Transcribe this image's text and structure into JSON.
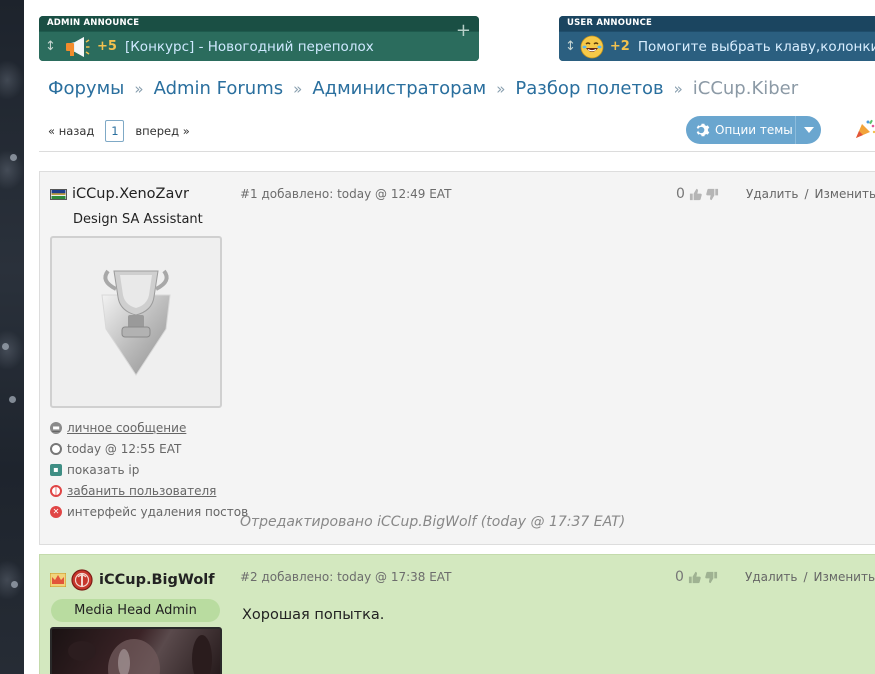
{
  "announce_admin": {
    "tag": "ADMIN ANNOUNCE",
    "score": "+5",
    "text": "[Конкурс] - Новогодний переполох",
    "icon": "megaphone-icon"
  },
  "announce_user": {
    "tag": "USER ANNOUNCE",
    "score": "+2",
    "text": "Помогите выбрать клаву,колонки,нау",
    "icon": "laughing-emoji-icon"
  },
  "breadcrumb": {
    "items": [
      "Форумы",
      "Admin Forums",
      "Администраторам",
      "Разбор полетов"
    ],
    "current": "iCCup.Kiber",
    "separator": "»"
  },
  "pager": {
    "prev": "« назад",
    "page": "1",
    "next": "вперед »"
  },
  "toolbar": {
    "options_label": "Опции темы"
  },
  "posts": [
    {
      "author": "iCCup.XenoZavr",
      "role": "Design SA Assistant",
      "meta": "#1 добавлено: today @ 12:49 EAT",
      "rating": "0",
      "delete": "Удалить",
      "edit": "Изменить",
      "actions": [
        "личное сообщение",
        "today @ 12:55 EAT",
        "показать ip",
        "забанить пользователя",
        "интерфейс удаления постов"
      ],
      "edited": "Отредактировано iCCup.BigWolf (today @ 17:37 EAT)"
    },
    {
      "author": "iCCup.BigWolf",
      "role": "Media Head Admin",
      "meta": "#2 добавлено: today @ 17:38 EAT",
      "rating": "0",
      "delete": "Удалить",
      "edit": "Изменить",
      "body": "Хорошая попытка."
    }
  ],
  "colors": {
    "link": "#2a6f9e",
    "admin_bar": "#2b6c5d",
    "user_bar": "#2b5f80",
    "score": "#f2c14e",
    "post2_bg": "#d3e8bf"
  }
}
